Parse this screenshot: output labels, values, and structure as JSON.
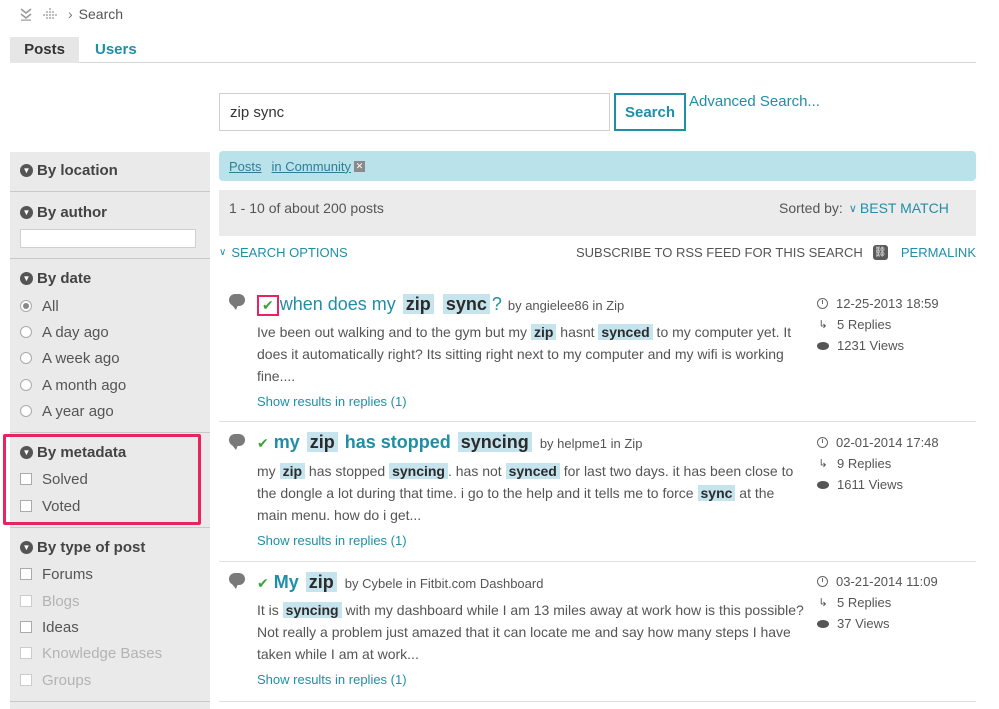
{
  "breadcrumb": {
    "current": "Search"
  },
  "tabs": [
    {
      "label": "Posts",
      "active": true
    },
    {
      "label": "Users",
      "active": false
    }
  ],
  "search": {
    "value": "zip sync",
    "button_label": "Search",
    "advanced_label": "Advanced Search..."
  },
  "sidebar": {
    "location_title": "By location",
    "author_title": "By author",
    "date_title": "By date",
    "date_options": [
      "All",
      "A day ago",
      "A week ago",
      "A month ago",
      "A year ago"
    ],
    "metadata_title": "By metadata",
    "metadata_options": [
      "Solved",
      "Voted"
    ],
    "type_title": "By type of post",
    "type_options": [
      "Forums",
      "Blogs",
      "Ideas",
      "Knowledge Bases",
      "Groups"
    ]
  },
  "filters": {
    "posts_link": "Posts",
    "community_link": "in Community"
  },
  "results_bar": {
    "count_text": "1 - 10 of about 200 posts",
    "sorted_label": "Sorted by:",
    "sorted_value": "BEST MATCH"
  },
  "options_row": {
    "search_options": "SEARCH OPTIONS",
    "rss_label": "SUBSCRIBE TO RSS FEED FOR THIS SEARCH",
    "permalink": "PERMALINK"
  },
  "results": [
    {
      "title_parts": [
        "when does my ",
        "zip",
        " ",
        "sync",
        "?"
      ],
      "by": "by angielee86 in Zip",
      "body": "Ive been out walking and to the gym but my zip hasnt synced to my computer yet. It does it automatically right? Its sitting right next to my computer and my wifi is working fine....",
      "show_replies": "Show results in replies (1)",
      "date": "12-25-2013 18:59",
      "replies": "5 Replies",
      "views": "1231 Views"
    },
    {
      "title_parts": [
        "my ",
        "zip",
        " has stopped ",
        "syncing"
      ],
      "by": "by helpme1 in Zip",
      "body": "my zip has stopped syncing.  has not synced for last two days.  it has been close to the dongle a lot during that time.  i go to the help and it tells me to force sync at the main menu.  how do i get...",
      "show_replies": "Show results in replies (1)",
      "date": "02-01-2014 17:48",
      "replies": "9 Replies",
      "views": "1611 Views"
    },
    {
      "title_parts": [
        "My ",
        "zip"
      ],
      "by": "by Cybele in Fitbit.com Dashboard",
      "body": "It is syncing with my dashboard while I am 13 miles away at work how is this possible?   Not really a problem just amazed that it can locate me and say how many steps I have taken while I am at work...",
      "show_replies": "Show results in replies (1)",
      "date": "03-21-2014 11:09",
      "replies": "5 Replies",
      "views": "37 Views"
    }
  ]
}
